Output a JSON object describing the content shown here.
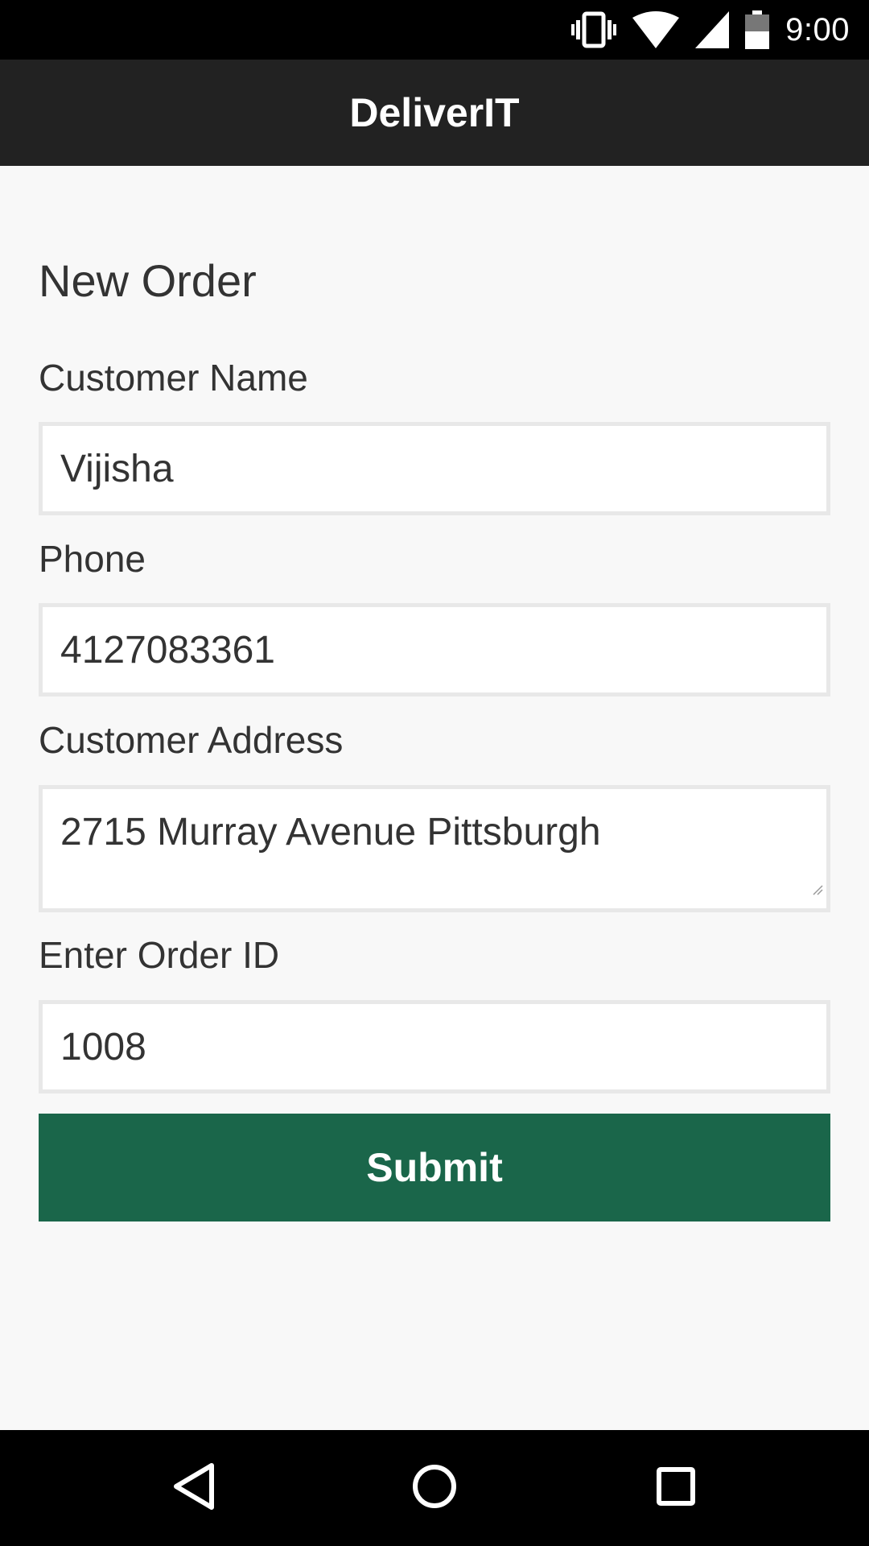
{
  "status_bar": {
    "time": "9:00"
  },
  "app_bar": {
    "title": "DeliverIT"
  },
  "form": {
    "title": "New Order",
    "customer_name": {
      "label": "Customer Name",
      "value": "Vijisha"
    },
    "phone": {
      "label": "Phone",
      "value": "4127083361"
    },
    "address": {
      "label": "Customer Address",
      "value": "2715 Murray Avenue Pittsburgh"
    },
    "order_id": {
      "label": "Enter Order ID",
      "value": "1008"
    },
    "submit_label": "Submit"
  },
  "colors": {
    "app_bar": "#222222",
    "submit": "#1a664a",
    "background": "#f8f8f8"
  },
  "icons": {
    "status": [
      "vibrate-icon",
      "wifi-icon",
      "cell-signal-icon",
      "battery-icon"
    ],
    "nav": [
      "back-icon",
      "home-icon",
      "recents-icon"
    ]
  }
}
